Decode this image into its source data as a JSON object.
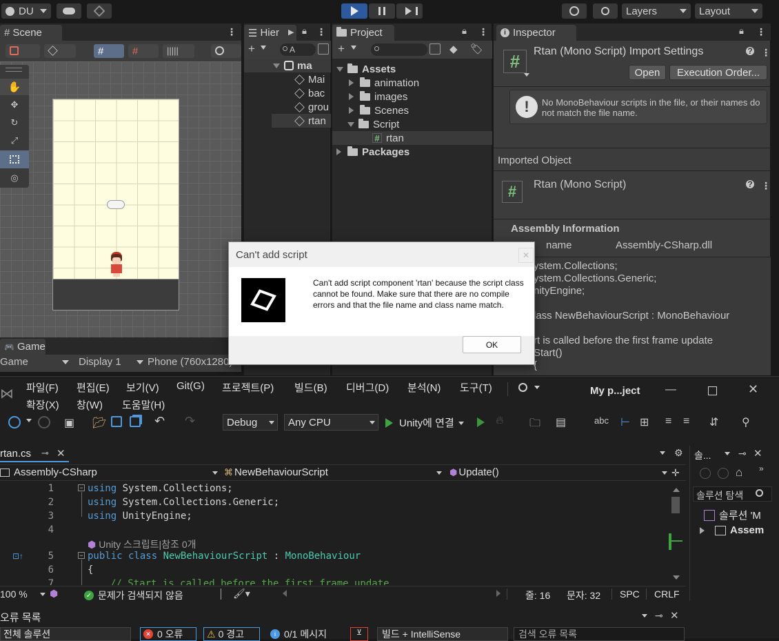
{
  "unity": {
    "account": "DU",
    "layers": "Layers",
    "layout": "Layout",
    "scene_tab": "Scene",
    "hierarchy_tab": "Hier",
    "project_tab": "Project",
    "inspector_tab": "Inspector",
    "game_tab": "Game",
    "game_dropdown": "Game",
    "display_dropdown": "Display 1",
    "resolution_dropdown": "Phone (760x1280)",
    "hierarchy_search": "A",
    "hierarchy_items": [
      "ma",
      "Mai",
      "bac",
      "grou",
      "rtan"
    ],
    "project_tree": {
      "assets": "Assets",
      "animation": "animation",
      "images": "images",
      "scenes": "Scenes",
      "script": "Script",
      "rtan": "rtan",
      "packages": "Packages"
    },
    "inspector": {
      "title": "Rtan (Mono Script) Import Settings",
      "open_button": "Open",
      "execution_order_button": "Execution Order...",
      "warning": "No MonoBehaviour scripts in the file, or their names do not match the file name.",
      "imported_object_label": "Imported Object",
      "imported_object_name": "Rtan (Mono Script)",
      "assembly_info_label": "Assembly Information",
      "filename_label": "name",
      "filename_value": "Assembly-CSharp.dll",
      "preview_lines": [
        "ystem.Collections;",
        "ystem.Collections.Generic;",
        "nityEngine;",
        "",
        "lass NewBehaviourScript : MonoBehaviour",
        "",
        "rt is called before the first frame update",
        "Start()",
        "{"
      ]
    }
  },
  "dialog": {
    "title": "Can't add script",
    "message": "Can't add script component 'rtan' because the script class cannot be found. Make sure that there are no compile errors and that the file name and class name match.",
    "ok": "OK"
  },
  "vs": {
    "menu": [
      "파일(F)",
      "편집(E)",
      "보기(V)",
      "Git(G)",
      "프로젝트(P)",
      "빌드(B)",
      "디버그(D)",
      "분석(N)",
      "도구(T)",
      "확장(X)",
      "창(W)",
      "도움말(H)"
    ],
    "project_title": "My p...ject",
    "config": "Debug",
    "platform": "Any CPU",
    "run_label": "Unity에 연결",
    "file_tab": "rtan.cs",
    "nav_project": "Assembly-CSharp",
    "nav_class": "NewBehaviourScript",
    "nav_member": "Update()",
    "lines": [
      "1",
      "2",
      "3",
      "4",
      "5",
      "6",
      "7"
    ],
    "code_refs": "Unity 스크립트|참조 0개",
    "code": {
      "l1_kw": "using",
      "l1_rest": " System.Collections;",
      "l2_kw": "using",
      "l2_rest": " System.Collections.Generic;",
      "l3_kw": "using",
      "l3_rest": " UnityEngine;",
      "l5_kw": "public class",
      "l5_name": " NewBehaviourScript",
      "l5_sep": " : ",
      "l5_base": "MonoBehaviour",
      "l6": "{",
      "l7": "// Start is called before the first frame update"
    },
    "zoom": "100 %",
    "no_issues": "문제가 검색되지 않음",
    "line_info": "줄: 16",
    "col_info": "문자: 32",
    "spc": "SPC",
    "crlf": "CRLF",
    "solution_panel_title": "솔...",
    "solution_search": "솔루션 탐색",
    "solution_item": "솔루션 'M",
    "assembly_item": "Assem",
    "error_list_title": "오류 목록",
    "error_scope": "전체 솔루션",
    "errors": "0 오류",
    "warnings": "0 경고",
    "messages": "0/1 메시지",
    "build_filter": "빌드 + IntelliSense",
    "search_errors": "검색 오류 목록"
  },
  "colors": {
    "accent": "#2d5a9e",
    "scene_bg": "#fffde0",
    "error": "#e0453a",
    "ok_green": "#3fa33f"
  }
}
